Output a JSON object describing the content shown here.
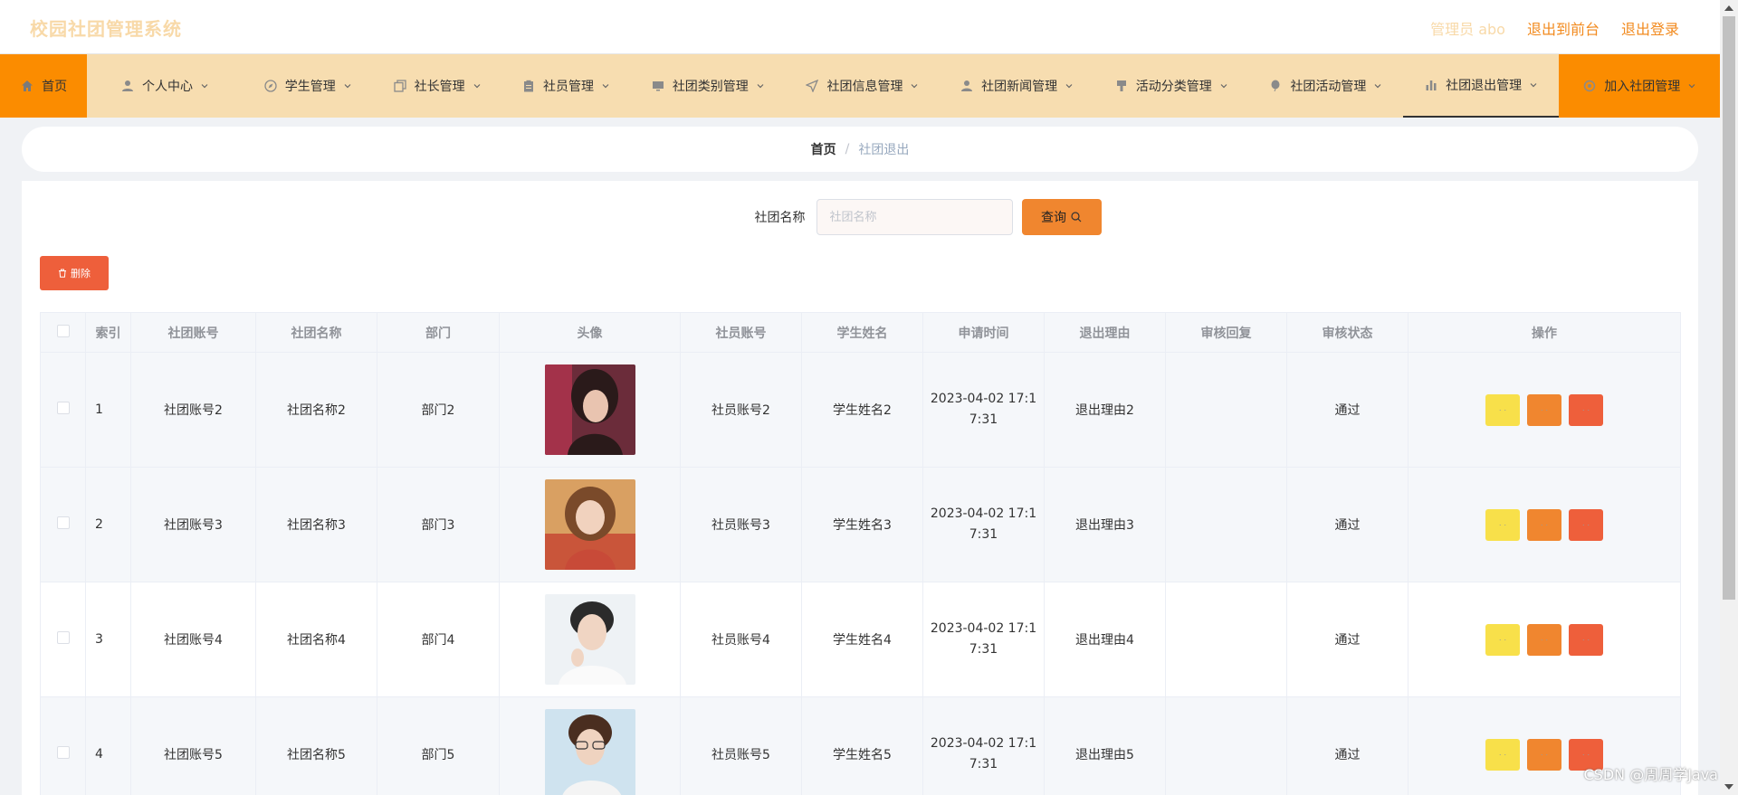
{
  "header": {
    "app_title": "校园社团管理系统",
    "admin_label": "管理员 abo",
    "front_link": "退出到前台",
    "logout_link": "退出登录"
  },
  "nav": {
    "items": [
      {
        "label": "首页",
        "icon": "home-icon"
      },
      {
        "label": "个人中心",
        "icon": "user-icon"
      },
      {
        "label": "学生管理",
        "icon": "compass-icon"
      },
      {
        "label": "社长管理",
        "icon": "copy-icon"
      },
      {
        "label": "社员管理",
        "icon": "clipboard-icon"
      },
      {
        "label": "社团类别管理",
        "icon": "monitor-icon"
      },
      {
        "label": "社团信息管理",
        "icon": "send-icon"
      },
      {
        "label": "社团新闻管理",
        "icon": "person-icon"
      },
      {
        "label": "活动分类管理",
        "icon": "brush-icon"
      },
      {
        "label": "社团活动管理",
        "icon": "balloon-icon"
      },
      {
        "label": "社团退出管理",
        "icon": "bar-chart-icon"
      },
      {
        "label": "加入社团管理",
        "icon": "settings-icon"
      }
    ],
    "active_index": 10
  },
  "breadcrumb": {
    "home": "首页",
    "separator": "/",
    "current": "社团退出"
  },
  "search": {
    "label": "社团名称",
    "placeholder": "社团名称",
    "button_label": "查询"
  },
  "toolbar": {
    "delete_label": "删除"
  },
  "table": {
    "columns": [
      "索引",
      "社团账号",
      "社团名称",
      "部门",
      "头像",
      "社员账号",
      "学生姓名",
      "申请时间",
      "退出理由",
      "审核回复",
      "审核状态",
      "操作"
    ],
    "rows": [
      {
        "index": "1",
        "club_account": "社团账号2",
        "club_name": "社团名称2",
        "dept": "部门2",
        "member_account": "社员账号2",
        "student_name": "学生姓名2",
        "time_line1": "2023-04-02 17:1",
        "time_line2": "7:31",
        "reason": "退出理由2",
        "reply": "",
        "status": "通过"
      },
      {
        "index": "2",
        "club_account": "社团账号3",
        "club_name": "社团名称3",
        "dept": "部门3",
        "member_account": "社员账号3",
        "student_name": "学生姓名3",
        "time_line1": "2023-04-02 17:1",
        "time_line2": "7:31",
        "reason": "退出理由3",
        "reply": "",
        "status": "通过"
      },
      {
        "index": "3",
        "club_account": "社团账号4",
        "club_name": "社团名称4",
        "dept": "部门4",
        "member_account": "社员账号4",
        "student_name": "学生姓名4",
        "time_line1": "2023-04-02 17:1",
        "time_line2": "7:31",
        "reason": "退出理由4",
        "reply": "",
        "status": "通过"
      },
      {
        "index": "4",
        "club_account": "社团账号5",
        "club_name": "社团名称5",
        "dept": "部门5",
        "member_account": "社员账号5",
        "student_name": "学生姓名5",
        "time_line1": "2023-04-02 17:1",
        "time_line2": "7:31",
        "reason": "退出理由5",
        "reply": "",
        "status": "通过"
      }
    ]
  },
  "watermark": "CSDN @周周学Java",
  "colors": {
    "accent_orange": "#fb8c00",
    "nav_bg": "#f7ddb0",
    "view_btn": "#f8e04a",
    "edit_btn": "#f0862f",
    "delete_btn": "#ee5f3b",
    "title_color": "#f8d9a8"
  }
}
